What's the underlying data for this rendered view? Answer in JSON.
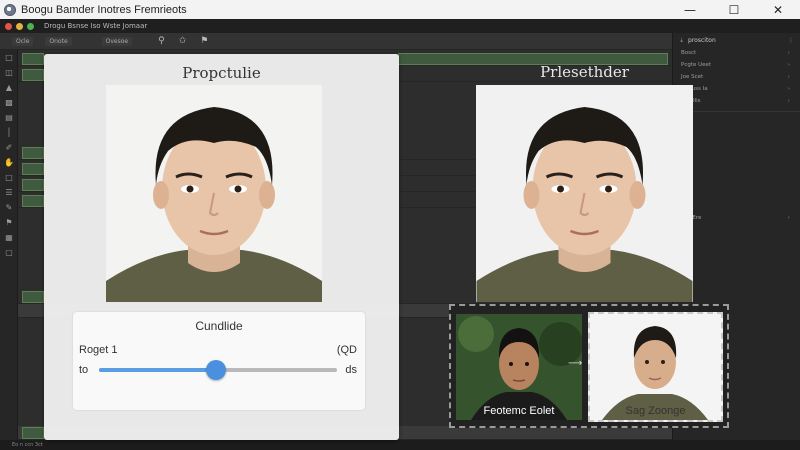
{
  "window": {
    "title": "Boogu Bamder Inotres Fremrieots"
  },
  "menubar": {
    "text": "Drogu Bsnse    Iso Wste Jomaar"
  },
  "toolbar": {
    "items": [
      "Ocle",
      "Onote",
      "Ovesoe"
    ],
    "icons": [
      "search-icon",
      "dropper-icon",
      "lock-icon"
    ]
  },
  "left_card": {
    "title": "Propctulie"
  },
  "control": {
    "title": "Cundlide",
    "left_label": "Roget 1",
    "right_label": "(QD",
    "min_label": "to",
    "max_label": "ds",
    "slider_value": 0.49
  },
  "right_preview": {
    "title": "Prlesethder"
  },
  "compare": {
    "before_label": "Feotemc Eolet",
    "after_label": "Sag Zoonge"
  },
  "right_panel": {
    "header": "prosciton",
    "items": [
      "Bosct",
      "Pcgte Ueet",
      "Joe Scet",
      "Stinuss Ia",
      "Ge Dlis",
      "Giir Ere"
    ]
  },
  "status": {
    "text": "Eo n ccn   3ct"
  },
  "colors": {
    "accent": "#4a90df",
    "shirt": "#5e5f45",
    "hair": "#1e1a16",
    "skin": "#e8c4a8"
  }
}
